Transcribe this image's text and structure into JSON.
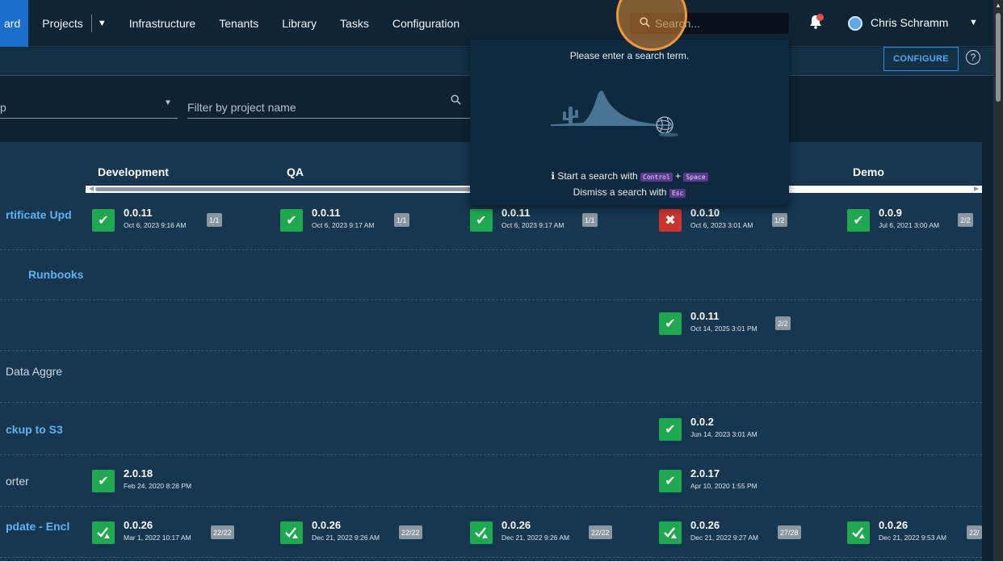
{
  "nav": {
    "items": [
      {
        "label": "ard"
      },
      {
        "label": "Projects"
      },
      {
        "label": "Infrastructure"
      },
      {
        "label": "Tenants"
      },
      {
        "label": "Library"
      },
      {
        "label": "Tasks"
      },
      {
        "label": "Configuration"
      }
    ],
    "search_placeholder": "Search...",
    "user_name": "Chris Schramm"
  },
  "subheader": {
    "configure_label": "CONFIGURE",
    "help_glyph": "?"
  },
  "filters": {
    "group_value": "p",
    "project_placeholder": "Filter by project name"
  },
  "environments": [
    "Development",
    "QA",
    "Demo"
  ],
  "projects": [
    {
      "name": "rtificate Upd"
    },
    {
      "name": "Runbooks"
    },
    {
      "name": ""
    },
    {
      "name": "Data Aggre"
    },
    {
      "name": "ckup to S3"
    },
    {
      "name": "orter"
    },
    {
      "name": "pdate - Encl"
    }
  ],
  "releases": {
    "r1_dev": {
      "version": "0.0.11",
      "date": "Oct 6, 2023 9:16 AM",
      "badge": "1/1",
      "status": "success"
    },
    "r1_qa": {
      "version": "0.0.11",
      "date": "Oct 6, 2023 9:17 AM",
      "badge": "1/1",
      "status": "success"
    },
    "r1_e3": {
      "version": "0.0.11",
      "date": "Oct 6, 2023 9:17 AM",
      "badge": "1/1",
      "status": "success"
    },
    "r1_e4": {
      "version": "0.0.10",
      "date": "Oct 6, 2023 3:01 AM",
      "badge": "1/2",
      "status": "failed"
    },
    "r1_demo": {
      "version": "0.0.9",
      "date": "Jul 6, 2021 3:00 AM",
      "badge": "2/2",
      "status": "success"
    },
    "r3_e4": {
      "version": "0.0.11",
      "date": "Oct 14, 2025 3:01 PM",
      "badge": "2/2",
      "status": "success"
    },
    "r5_e4": {
      "version": "0.0.2",
      "date": "Jun 14, 2023 3:01 AM",
      "status": "success"
    },
    "r6_dev": {
      "version": "2.0.18",
      "date": "Feb 24, 2020 8:28 PM",
      "status": "success"
    },
    "r6_e4": {
      "version": "2.0.17",
      "date": "Apr 10, 2020 1:55 PM",
      "status": "success"
    },
    "r7_dev": {
      "version": "0.0.26",
      "date": "Mar 1, 2022 10:17 AM",
      "badge": "22/22",
      "status": "success-warning"
    },
    "r7_qa": {
      "version": "0.0.26",
      "date": "Dec 21, 2022 9:26 AM",
      "badge": "22/22",
      "status": "success-warning"
    },
    "r7_e3": {
      "version": "0.0.26",
      "date": "Dec 21, 2022 9:26 AM",
      "badge": "22/22",
      "status": "success-warning"
    },
    "r7_e4": {
      "version": "0.0.26",
      "date": "Dec 21, 2022 9:27 AM",
      "badge": "27/28",
      "status": "success-warning"
    },
    "r7_demo": {
      "version": "0.0.26",
      "date": "Dec 21, 2022 9:53 AM",
      "badge": "22/",
      "status": "success-warning"
    }
  },
  "search_dropdown": {
    "message": "Please enter a search term.",
    "tip_prefix": "Start a search with",
    "tip_key1": "Control",
    "tip_plus": "+",
    "tip_key2": "Space",
    "dismiss_prefix": "Dismiss a search with",
    "dismiss_key": "Esc"
  },
  "colors": {
    "nav_bg": "#0f2535",
    "active_nav": "#1a6fcb",
    "panel_bg": "#173650",
    "success": "#1fa84f",
    "failed": "#c9362f",
    "link": "#5eb3f3",
    "highlight": "#f0973a"
  },
  "icons": {
    "search": "search-icon",
    "bell": "bell-icon",
    "user": "user-avatar-icon",
    "check": "check-icon",
    "cross": "cross-icon",
    "help": "help-icon"
  }
}
